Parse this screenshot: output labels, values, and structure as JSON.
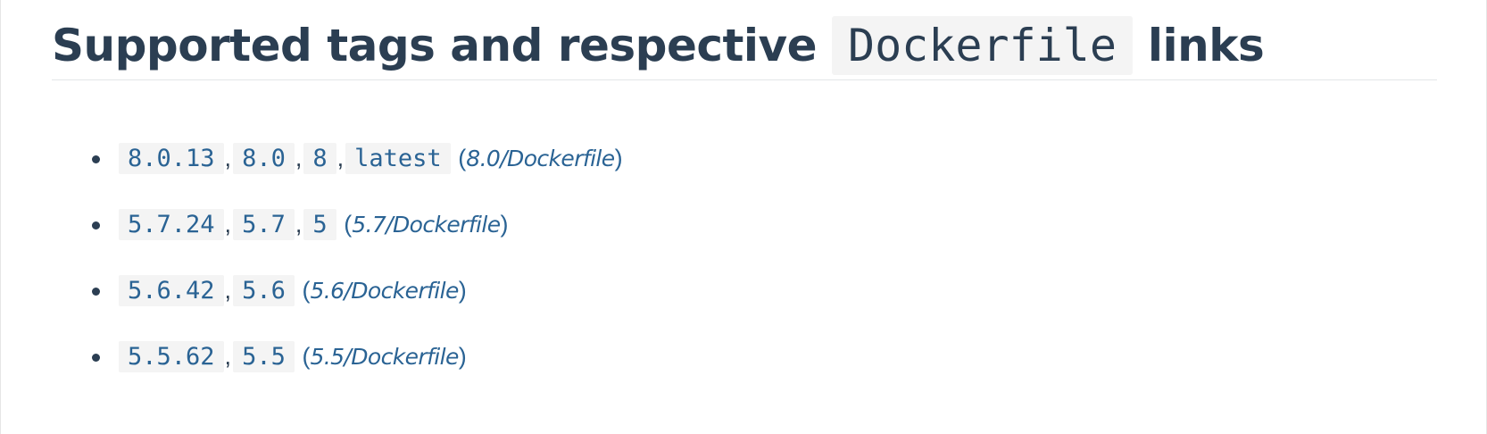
{
  "heading": {
    "text_before": "Supported tags and respective ",
    "code": "Dockerfile",
    "text_after": " links"
  },
  "tag_groups": [
    {
      "tags": [
        "8.0.13",
        "8.0",
        "8",
        "latest"
      ],
      "link": "8.0/Dockerfile"
    },
    {
      "tags": [
        "5.7.24",
        "5.7",
        "5"
      ],
      "link": "5.7/Dockerfile"
    },
    {
      "tags": [
        "5.6.42",
        "5.6"
      ],
      "link": "5.6/Dockerfile"
    },
    {
      "tags": [
        "5.5.62",
        "5.5"
      ],
      "link": "5.5/Dockerfile"
    }
  ],
  "separator": ",",
  "paren_open": "(",
  "paren_close": ")",
  "colors": {
    "heading": "#2b3e52",
    "link": "#2a6394",
    "code_bg": "#f4f4f4"
  }
}
